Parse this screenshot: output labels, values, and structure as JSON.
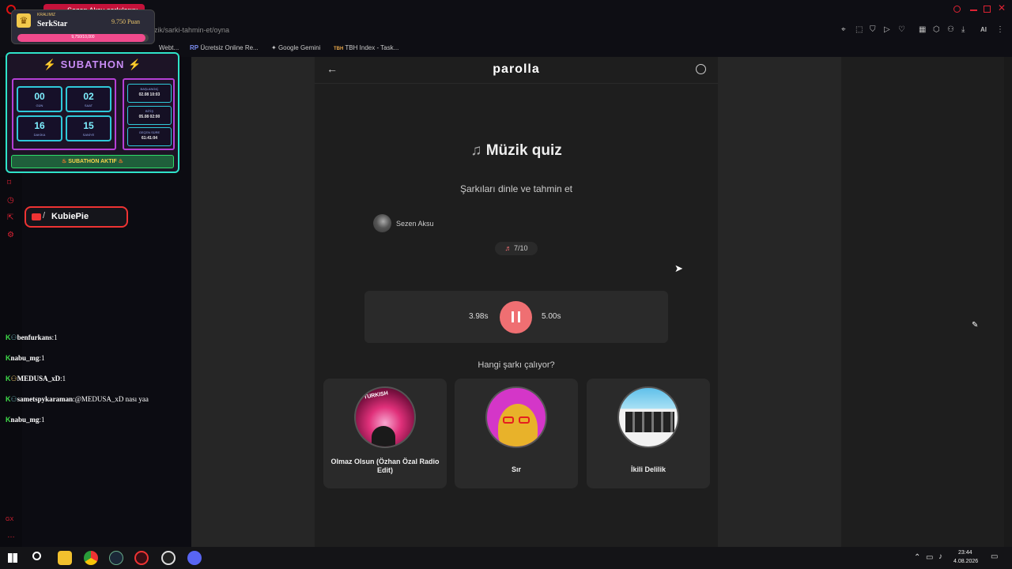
{
  "browser": {
    "tab_title": "Sezen Aksu şarkılarını",
    "url": "uzik/sarki-tahmin-et/oyna",
    "bookmarks": [
      "Webt...",
      "Ücretsiz Online Re...",
      "Google Gemini",
      "TBH Index - Task..."
    ],
    "ai_label": "AI"
  },
  "overlay": {
    "kral_label": "KRALIMIZ",
    "kral_name": "SerkStar",
    "kral_points": "9.750 Puan",
    "kral_progress": "9,750/10,000",
    "kral_fraction": 0.975,
    "subathon_title": "SUBATHON",
    "timer": [
      {
        "value": "00",
        "label": "GÜN"
      },
      {
        "value": "02",
        "label": "SAAT"
      },
      {
        "value": "16",
        "label": "DAKİKA"
      },
      {
        "value": "15",
        "label": "SANİYE"
      }
    ],
    "info": [
      {
        "label": "BAŞLANGIÇ",
        "value": "02.08 10:03"
      },
      {
        "label": "BİTİŞ",
        "value": "05.08 02:00"
      },
      {
        "label": "GEÇEN SÜRE",
        "value": "61:41:04"
      }
    ],
    "subathon_status": "SUBATHON AKTIF",
    "streamer_name": "KubiePie"
  },
  "chat": [
    {
      "user": "benfurkans",
      "message": "1"
    },
    {
      "user": "nabu_mg",
      "message": "1"
    },
    {
      "user": "MEDUSA_xD",
      "message": "1"
    },
    {
      "user": "sametspykaraman",
      "message": "@MEDUSA_xD nası yaa"
    },
    {
      "user": "nabu_mg",
      "message": "1"
    }
  ],
  "app": {
    "logo": "parolla",
    "title": "Müzik quiz",
    "subtitle": "Şarkıları dinle ve tahmin et",
    "artist": "Sezen Aksu",
    "progress": "7/10",
    "elapsed": "3.98s",
    "duration": "5.00s",
    "question": "Hangi şarkı çalıyor?",
    "choices": [
      {
        "title": "Olmaz Olsun (Özhan Özal Radio Edit)"
      },
      {
        "title": "Sır"
      },
      {
        "title": "İkili Delilik"
      }
    ]
  },
  "taskbar": {
    "time": "23:44",
    "date": "4.08.2026"
  },
  "colors": {
    "accent": "#ef6f72",
    "panel": "#1e1e1e",
    "overlay_border": "#2fe3c9"
  }
}
